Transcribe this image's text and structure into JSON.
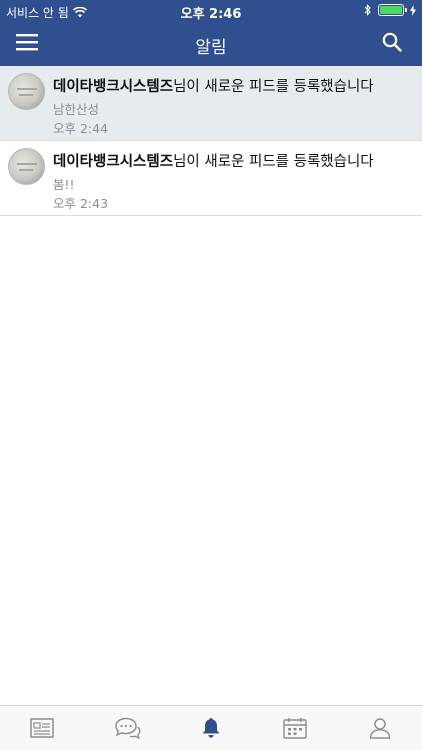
{
  "status_bar": {
    "carrier": "서비스 안 됨",
    "time": "오후 2:46"
  },
  "header": {
    "title": "알림"
  },
  "notifications": [
    {
      "author": "데이타뱅크시스템즈",
      "message": "님이 새로운 피드를 등록했습니다",
      "preview": "남한산성",
      "time": "오후 2:44"
    },
    {
      "author": "데이타뱅크시스템즈",
      "message": "님이 새로운 피드를 등록했습니다",
      "preview": "봄!!",
      "time": "오후 2:43"
    }
  ],
  "tabbar": {
    "active_tab": "notifications",
    "tabs": [
      "feed-icon",
      "chat-icon",
      "bell-icon",
      "calendar-icon",
      "profile-icon"
    ]
  },
  "colors": {
    "header_bg": "#2f4f8e",
    "highlight_row": "#e6ebef",
    "active_tab": "#2f4f8e",
    "inactive_tab": "#8c8c8c",
    "battery": "#4cd964"
  }
}
